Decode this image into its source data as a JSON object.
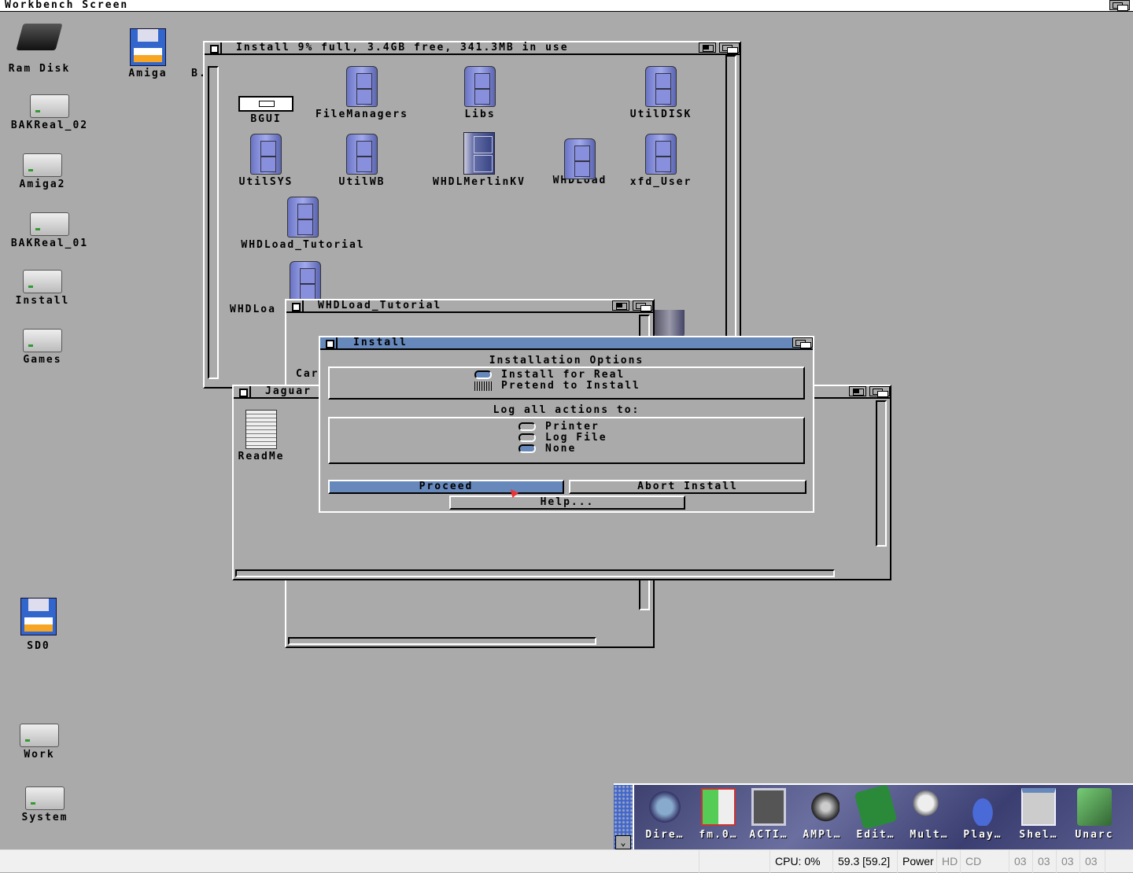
{
  "screen": {
    "title": "Workbench Screen"
  },
  "desktop_icons": [
    {
      "label": "Ram Disk",
      "icon": "ram-chip-icon"
    },
    {
      "label": "Amiga",
      "icon": "floppy-icon"
    },
    {
      "label": "B.",
      "icon": "disk-icon"
    },
    {
      "label": "BAKReal_02",
      "icon": "hard-disk-icon"
    },
    {
      "label": "Amiga2",
      "icon": "hard-disk-icon"
    },
    {
      "label": "BAKReal_01",
      "icon": "hard-disk-icon"
    },
    {
      "label": "Install",
      "icon": "hard-disk-icon"
    },
    {
      "label": "Games",
      "icon": "hard-disk-icon"
    },
    {
      "label": "SD0",
      "icon": "floppy-icon"
    },
    {
      "label": "Work",
      "icon": "hard-disk-icon"
    },
    {
      "label": "System",
      "icon": "hard-disk-icon"
    }
  ],
  "install_window": {
    "title": "Install   9% full, 3.4GB free, 341.3MB in use",
    "items": [
      {
        "label": "BGUI",
        "icon": "tool-icon"
      },
      {
        "label": "FileManagers",
        "icon": "drawer-icon"
      },
      {
        "label": "Libs",
        "icon": "drawer-icon"
      },
      {
        "label": "UtilDISK",
        "icon": "drawer-icon"
      },
      {
        "label": "UtilSYS",
        "icon": "drawer-icon"
      },
      {
        "label": "UtilWB",
        "icon": "drawer-icon"
      },
      {
        "label": "WHDLMerlinKV",
        "icon": "cabinet-icon"
      },
      {
        "label": "WHDLoad",
        "icon": "drawer-icon"
      },
      {
        "label": "xfd_User",
        "icon": "drawer-icon"
      },
      {
        "label": "WHDLoad_Tutorial",
        "icon": "drawer-icon"
      },
      {
        "label": "WHDLoa",
        "icon": "drawer-icon"
      }
    ]
  },
  "tutorial_window": {
    "title": "WHDLoad_Tutorial",
    "partial_label": "Car"
  },
  "jaguar_window": {
    "title": "Jaguar",
    "items": [
      {
        "label": "ReadMe",
        "icon": "document-icon"
      }
    ]
  },
  "dialog": {
    "title": "Install",
    "options_heading": "Installation Options",
    "install_mode": [
      {
        "label": "Install for Real",
        "selected": true
      },
      {
        "label": "Pretend to Install",
        "selected": false
      }
    ],
    "log_heading": "Log all actions to:",
    "log_options": [
      {
        "label": "Printer",
        "selected": false
      },
      {
        "label": "Log File",
        "selected": false
      },
      {
        "label": "None",
        "selected": true
      }
    ],
    "proceed": "Proceed",
    "abort": "Abort Install",
    "help": "Help..."
  },
  "dock": {
    "items": [
      {
        "label": "Dire…",
        "icon": "directory-opus-icon"
      },
      {
        "label": "fm.0…",
        "icon": "file-manager-icon"
      },
      {
        "label": "ACTI…",
        "icon": "film-icon"
      },
      {
        "label": "AMPl…",
        "icon": "speaker-icon"
      },
      {
        "label": "Edit…",
        "icon": "notepad-icon"
      },
      {
        "label": "Mult…",
        "icon": "magnifier-icon"
      },
      {
        "label": "Play…",
        "icon": "player-icon"
      },
      {
        "label": "Shel…",
        "icon": "shell-icon"
      },
      {
        "label": "Unarc",
        "icon": "cube-icon"
      }
    ]
  },
  "status": {
    "cpu": "CPU: 0%",
    "fps": "59.3 [59.2]",
    "power": "Power",
    "hd": "HD",
    "cd": "CD",
    "drives": [
      "03",
      "03",
      "03",
      "03"
    ]
  },
  "colors": {
    "desktop": "#aaaaaa",
    "active_title": "#6688bb"
  }
}
